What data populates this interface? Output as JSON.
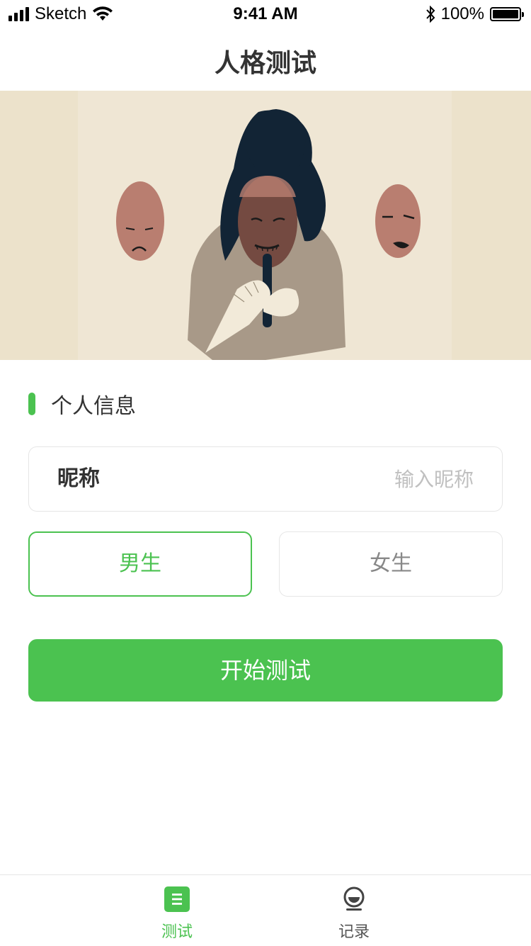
{
  "status_bar": {
    "carrier": "Sketch",
    "time": "9:41 AM",
    "battery_pct": "100%",
    "battery_level": 1.0
  },
  "nav": {
    "title": "人格测试"
  },
  "section": {
    "title": "个人信息"
  },
  "nickname": {
    "label": "昵称",
    "placeholder": "输入昵称",
    "value": ""
  },
  "gender": {
    "male_label": "男生",
    "female_label": "女生",
    "selected": "male"
  },
  "start_button": {
    "label": "开始测试"
  },
  "tabs": [
    {
      "label": "测试",
      "icon": "list-icon",
      "active": true
    },
    {
      "label": "记录",
      "icon": "record-icon",
      "active": false
    }
  ],
  "colors": {
    "accent": "#4bc250",
    "hero_bg": "#ece2cb",
    "text": "#333333",
    "placeholder": "#c0c0c0"
  }
}
